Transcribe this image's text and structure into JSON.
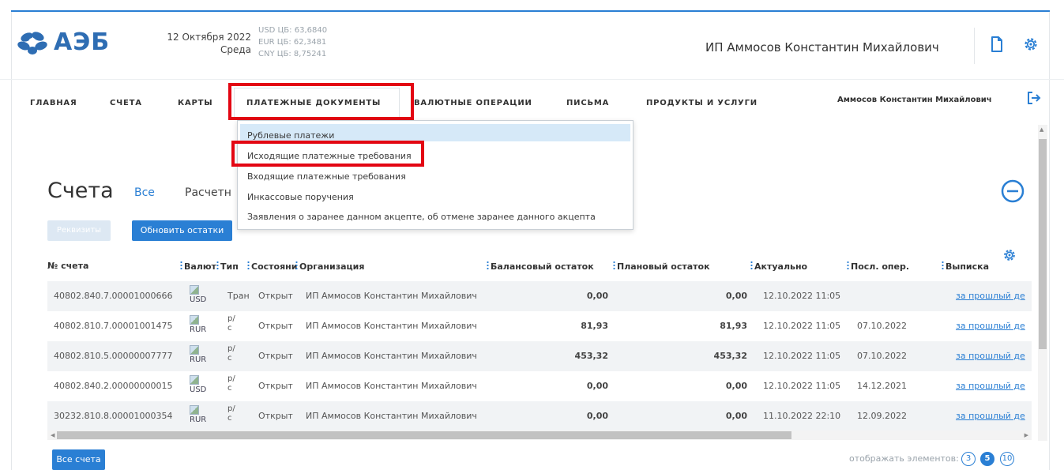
{
  "brand": {
    "name": "АЭБ"
  },
  "header": {
    "date": "12 Октября 2022",
    "weekday": "Среда",
    "rates": [
      "USD ЦБ: 63,6840",
      "EUR ЦБ: 62,3481",
      "CNY ЦБ: 8,75241"
    ],
    "user": "ИП Аммосов Константин Михайлович",
    "icons": [
      "document-icon",
      "gear-icon"
    ]
  },
  "nav": {
    "items": [
      "ГЛАВНАЯ",
      "СЧЕТА",
      "КАРТЫ",
      "ПЛАТЕЖНЫЕ ДОКУМЕНТЫ",
      "ВАЛЮТНЫЕ ОПЕРАЦИИ",
      "ПИСЬМА",
      "ПРОДУКТЫ И УСЛУГИ"
    ],
    "active": "ПЛАТЕЖНЫЕ ДОКУМЕНТЫ",
    "user": "Аммосов Константин Михайлович"
  },
  "dropdown": {
    "items": [
      "Рублевые платежи",
      "Исходящие платежные требования",
      "Входящие платежные требования",
      "Инкассовые поручения",
      "Заявления о заранее данном акцепте, об отмене заранее данного акцепта"
    ],
    "highlighted": "Рублевые платежи"
  },
  "content": {
    "title": "Счета",
    "tabs": [
      "Все",
      "Расчетн"
    ],
    "btn_requisites": "Реквизиты",
    "btn_refresh": "Обновить остатки"
  },
  "table": {
    "headers": [
      "№ счета",
      "Валют",
      "Тип",
      "Состояние",
      "Организация",
      "Балансовый остаток",
      "Плановый остаток",
      "Актуально",
      "Посл. опер.",
      "Выписка"
    ],
    "rows": [
      {
        "account": "40802.840.7.00001000666",
        "currency": "USD",
        "type": "Тран",
        "state": "Открыт",
        "org": "ИП Аммосов Константин Михайлович",
        "balance": "0,00",
        "planned": "0,00",
        "actual": "12.10.2022 11:05",
        "last_op": "",
        "statement": "за прошлый де"
      },
      {
        "account": "40802.810.7.00001001475",
        "currency": "RUR",
        "type": "р/с",
        "state": "Открыт",
        "org": "ИП Аммосов Константин Михайлович",
        "balance": "81,93",
        "planned": "81,93",
        "actual": "12.10.2022 11:05",
        "last_op": "07.10.2022",
        "statement": "за прошлый де"
      },
      {
        "account": "40802.810.5.00000007777",
        "currency": "RUR",
        "type": "р/с",
        "state": "Открыт",
        "org": "ИП Аммосов Константин Михайлович",
        "balance": "453,32",
        "planned": "453,32",
        "actual": "12.10.2022 11:05",
        "last_op": "07.10.2022",
        "statement": "за прошлый де"
      },
      {
        "account": "40802.840.2.00000000015",
        "currency": "USD",
        "type": "р/с",
        "state": "Открыт",
        "org": "ИП Аммосов Константин Михайлович",
        "balance": "0,00",
        "planned": "0,00",
        "actual": "12.10.2022 11:05",
        "last_op": "14.12.2021",
        "statement": "за прошлый де"
      },
      {
        "account": "30232.810.8.00001000354",
        "currency": "RUR",
        "type": "р/с",
        "state": "Открыт",
        "org": "ИП Аммосов Константин Михайлович",
        "balance": "0,00",
        "planned": "0,00",
        "actual": "11.10.2022 22:10",
        "last_op": "12.09.2022",
        "statement": "за прошлый де"
      }
    ]
  },
  "footer": {
    "btn_all": "Все счета",
    "page_label": "отображать элементов:",
    "page_sizes": [
      "3",
      "5",
      "10"
    ],
    "page_active": "5"
  },
  "colors": {
    "accent": "#2a7fd4",
    "highlight": "#e30613",
    "menu_hover": "#d6e9f8"
  }
}
